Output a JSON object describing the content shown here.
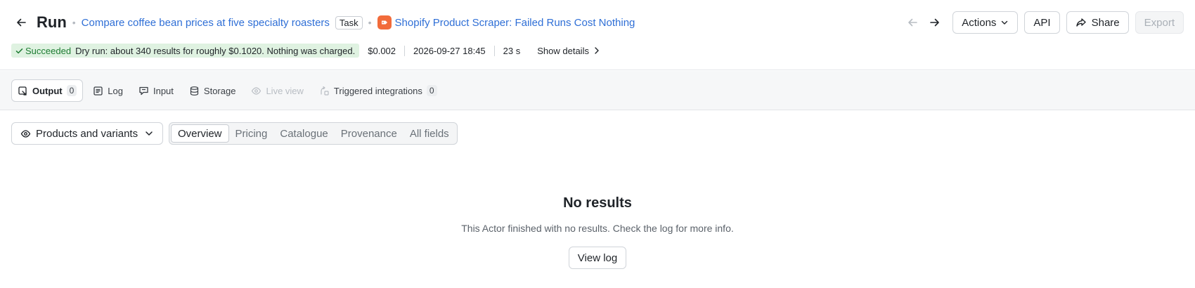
{
  "header": {
    "title": "Run",
    "task_name": "Compare coffee bean prices at five specialty roasters",
    "task_badge": "Task",
    "actor_name": "Shopify Product Scraper: Failed Runs Cost Nothing",
    "actor_icon": "tag-icon",
    "actions_label": "Actions",
    "api_label": "API",
    "share_label": "Share",
    "export_label": "Export"
  },
  "status": {
    "state": "Succeeded",
    "message": "Dry run: about 340 results for roughly $0.1020. Nothing was charged.",
    "cost": "$0.002",
    "started": "2026-09-27 18:45",
    "duration": "23 s",
    "details_label": "Show details"
  },
  "tabs": [
    {
      "label": "Output",
      "count": "0",
      "icon": "output-icon"
    },
    {
      "label": "Log",
      "icon": "log-icon"
    },
    {
      "label": "Input",
      "icon": "input-icon"
    },
    {
      "label": "Storage",
      "icon": "storage-icon"
    },
    {
      "label": "Live view",
      "icon": "eye-icon"
    },
    {
      "label": "Triggered integrations",
      "count": "0",
      "icon": "integrations-icon"
    }
  ],
  "view": {
    "selected": "Products and variants",
    "segments": [
      "Overview",
      "Pricing",
      "Catalogue",
      "Provenance",
      "All fields"
    ],
    "active_segment": "Overview"
  },
  "empty": {
    "title": "No results",
    "message": "This Actor finished with no results. Check the log for more info.",
    "button": "View log"
  },
  "colors": {
    "link": "#2f6fd6",
    "success_bg": "#dff2e1",
    "success_text": "#1e7c33",
    "actor_icon_bg": "#f26b3a"
  }
}
